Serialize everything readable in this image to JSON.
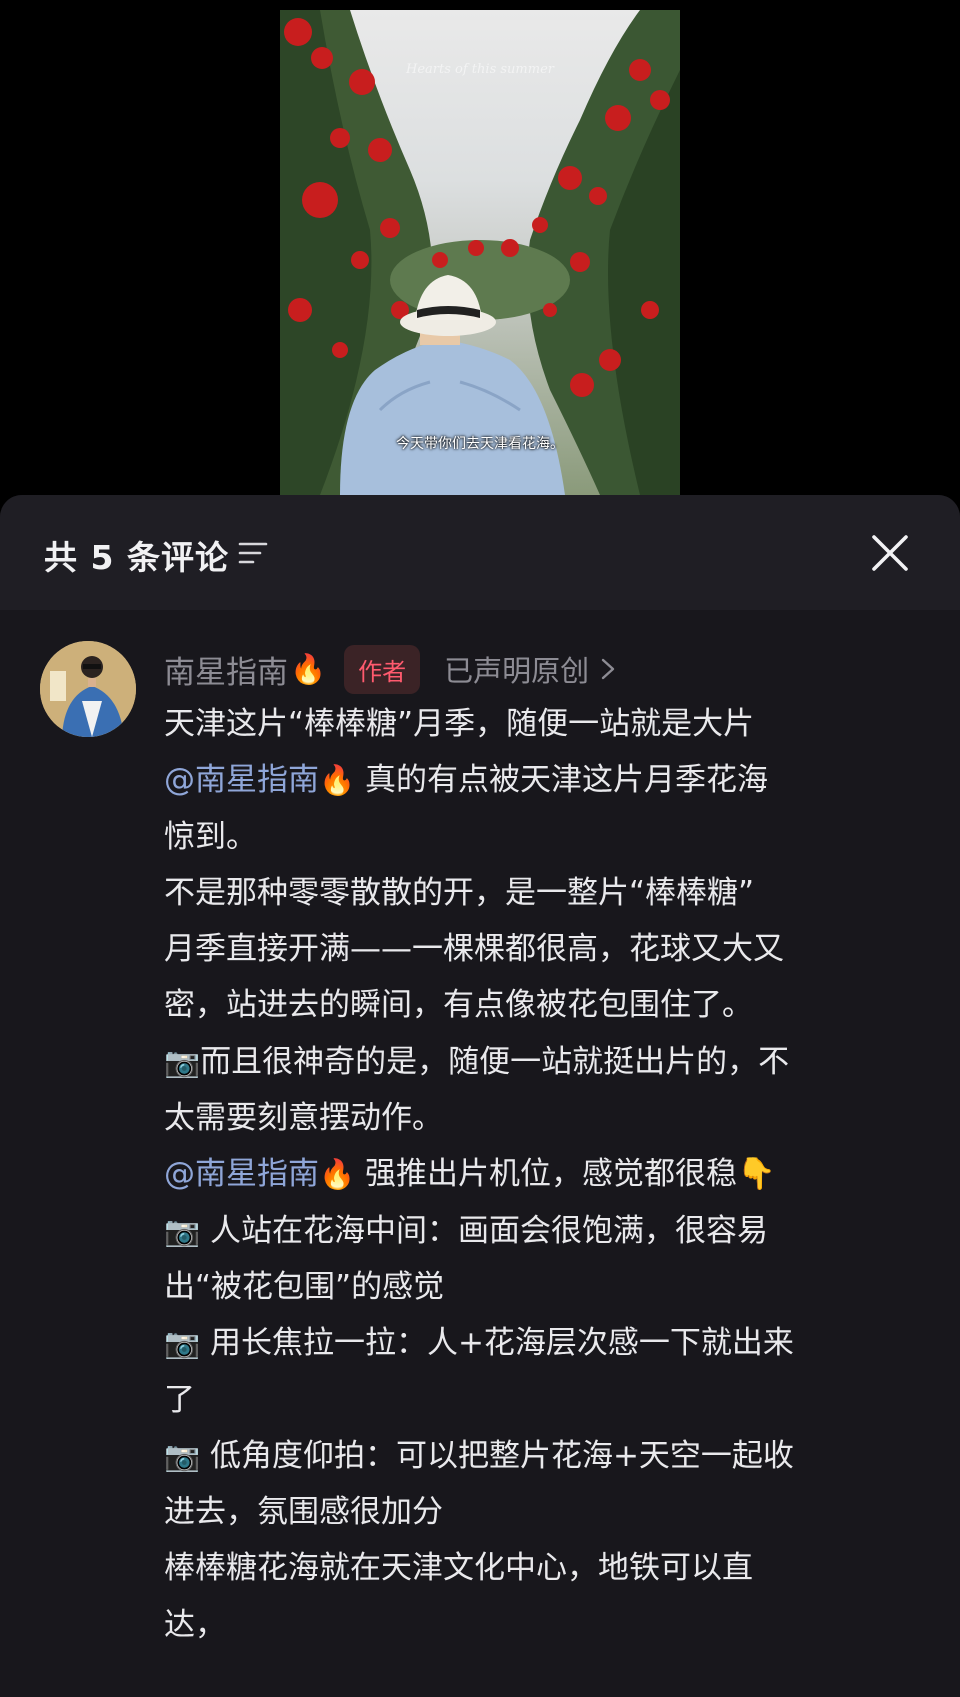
{
  "video": {
    "script_overlay": "Hearts of this summer",
    "caption": "今天带你们去天津看花海。"
  },
  "comments_panel": {
    "title": "共 5 条评论",
    "sort_icon": "sort-lines-icon",
    "close_icon": "close-x-icon"
  },
  "comment": {
    "author": "南星指南",
    "author_emoji": "🔥",
    "badge": "作者",
    "original_link": "已声明原创",
    "lines": [
      {
        "mention": "",
        "emoji": "",
        "text": "天津这片“棒棒糖”月季，随便一站就是大片"
      },
      {
        "mention": "@南星指南",
        "emoji": "🔥",
        "text": " 真的有点被天津这片月季花海"
      },
      {
        "mention": "",
        "emoji": "",
        "text": "惊到。"
      },
      {
        "mention": "",
        "emoji": "",
        "text": "不是那种零零散散的开，是一整片“棒棒糖”"
      },
      {
        "mention": "",
        "emoji": "",
        "text": "月季直接开满——一棵棵都很高，花球又大又"
      },
      {
        "mention": "",
        "emoji": "",
        "text": "密，站进去的瞬间，有点像被花包围住了。"
      },
      {
        "mention": "",
        "emoji": "📷",
        "text": "而且很神奇的是，随便一站就挺出片的，不"
      },
      {
        "mention": "",
        "emoji": "",
        "text": "太需要刻意摆动作。"
      },
      {
        "mention": "@南星指南",
        "emoji": "🔥",
        "text": " 强推出片机位，感觉都很稳👇"
      },
      {
        "mention": "",
        "emoji": "📷",
        "text": " 人站在花海中间：画面会很饱满，很容易"
      },
      {
        "mention": "",
        "emoji": "",
        "text": "出“被花包围”的感觉"
      },
      {
        "mention": "",
        "emoji": "📷",
        "text": " 用长焦拉一拉：人+花海层次感一下就出来"
      },
      {
        "mention": "",
        "emoji": "",
        "text": "了"
      },
      {
        "mention": "",
        "emoji": "📷",
        "text": " 低角度仰拍：可以把整片花海+天空一起收"
      },
      {
        "mention": "",
        "emoji": "",
        "text": "进去，氛围感很加分"
      },
      {
        "mention": "",
        "emoji": "",
        "text": "棒棒糖花海就在天津文化中心，地铁可以直"
      },
      {
        "mention": "",
        "emoji": "",
        "text": "达，"
      }
    ]
  },
  "colors": {
    "panel_bg": "#18171c",
    "header_bg": "#1f1e24",
    "badge_text": "#ff5a6e",
    "mention": "#8fa6d8"
  }
}
